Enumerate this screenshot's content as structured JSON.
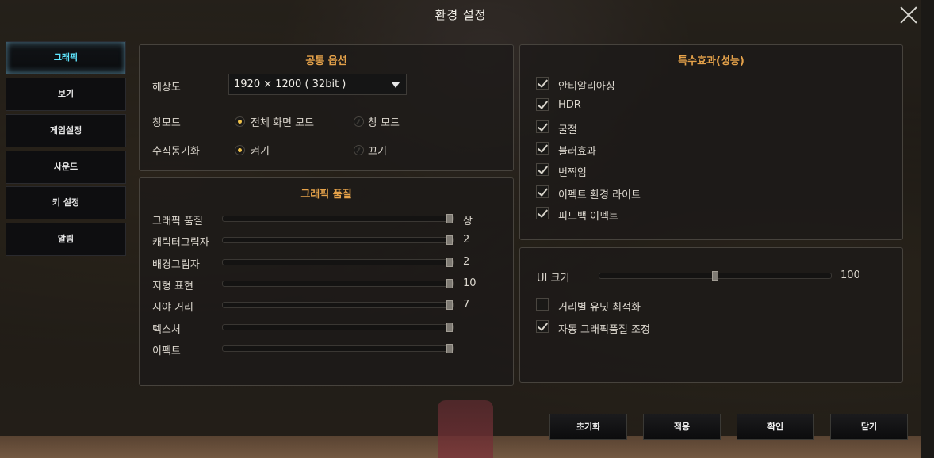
{
  "window": {
    "title": "환경 설정"
  },
  "sidebar": {
    "items": [
      {
        "label": "그래픽",
        "active": true
      },
      {
        "label": "보기",
        "active": false
      },
      {
        "label": "게임설정",
        "active": false
      },
      {
        "label": "사운드",
        "active": false
      },
      {
        "label": "키 설정",
        "active": false
      },
      {
        "label": "알림",
        "active": false
      }
    ]
  },
  "common": {
    "title": "공통 옵션",
    "resolution_label": "해상도",
    "resolution_value": "1920 × 1200 ( 32bit )",
    "window_mode_label": "창모드",
    "window_mode_options": [
      {
        "label": "전체 화면 모드",
        "selected": true
      },
      {
        "label": "창 모드",
        "selected": false
      }
    ],
    "vsync_label": "수직동기화",
    "vsync_options": [
      {
        "label": "켜기",
        "selected": true
      },
      {
        "label": "끄기",
        "selected": false
      }
    ]
  },
  "quality": {
    "title": "그래픽 품질",
    "sliders": [
      {
        "label": "그래픽 품질",
        "value_text": "상",
        "level": 1.0
      },
      {
        "label": "캐릭터그림자",
        "value_text": "2",
        "level": 1.0
      },
      {
        "label": "배경그림자",
        "value_text": "2",
        "level": 1.0
      },
      {
        "label": "지형 표현",
        "value_text": "10",
        "level": 1.0
      },
      {
        "label": "시야 거리",
        "value_text": "7",
        "level": 1.0
      },
      {
        "label": "텍스처",
        "value_text": "",
        "level": 1.0
      },
      {
        "label": "이펙트",
        "value_text": "",
        "level": 1.0
      }
    ]
  },
  "effects": {
    "title": "특수효과(성능)",
    "items": [
      {
        "label": "안티알리아싱",
        "checked": true
      },
      {
        "label": "HDR",
        "checked": true
      },
      {
        "label": "굴절",
        "checked": true
      },
      {
        "label": "블러효과",
        "checked": true
      },
      {
        "label": "번쩍임",
        "checked": true
      },
      {
        "label": "이펙트 환경 라이트",
        "checked": true
      },
      {
        "label": "피드백 이펙트",
        "checked": true
      }
    ]
  },
  "ui": {
    "ui_size_label": "UI 크기",
    "ui_size_value": "100",
    "ui_size_level": 0.5,
    "options": [
      {
        "label": "거리별 유닛 최적화",
        "checked": false
      },
      {
        "label": "자동 그래픽품질 조정",
        "checked": true
      }
    ]
  },
  "buttons": {
    "reset": "초기화",
    "apply": "적용",
    "confirm": "확인",
    "close": "닫기"
  },
  "colors": {
    "accent_orange": "#e5a24a",
    "active_tab_cyan": "#5fe6ff",
    "radio_on_yellow": "#f0c24a"
  }
}
